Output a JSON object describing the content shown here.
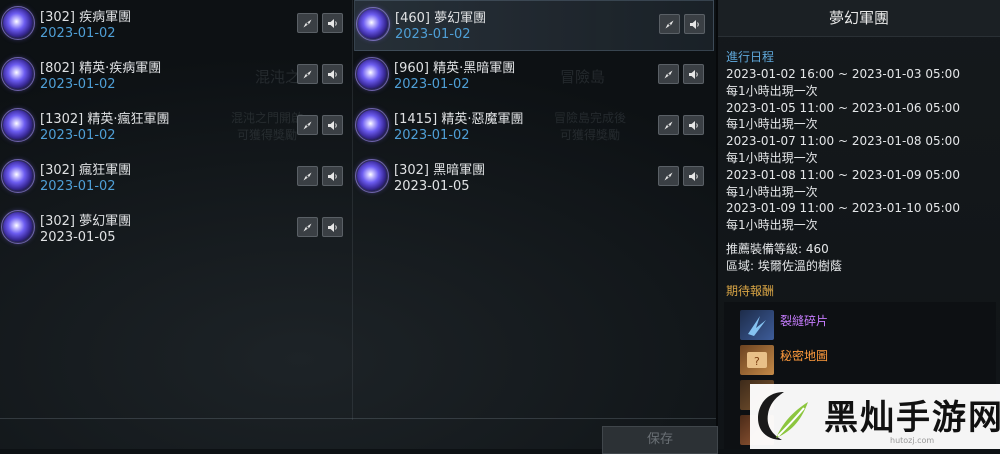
{
  "ghost_text": {
    "left_title": "混沌之",
    "left_sub1": "混沌之門開啟",
    "left_sub2": "可獲得獎勵",
    "mid_title": "冒險島",
    "mid_sub1": "冒險島完成後",
    "mid_sub2": "可獲得獎勵"
  },
  "left_list": [
    {
      "name": "[302] 疾病軍團",
      "date": "2023-01-02",
      "date_color": "blue"
    },
    {
      "name": "[802] 精英·疾病軍團",
      "date": "2023-01-02",
      "date_color": "blue"
    },
    {
      "name": "[1302] 精英·瘋狂軍團",
      "date": "2023-01-02",
      "date_color": "blue"
    },
    {
      "name": "[302] 瘋狂軍團",
      "date": "2023-01-02",
      "date_color": "blue"
    },
    {
      "name": "[302] 夢幻軍團",
      "date": "2023-01-05",
      "date_color": "white"
    }
  ],
  "mid_list": [
    {
      "name": "[460] 夢幻軍團",
      "date": "2023-01-02",
      "date_color": "blue",
      "selected": true
    },
    {
      "name": "[960] 精英·黑暗軍團",
      "date": "2023-01-02",
      "date_color": "blue"
    },
    {
      "name": "[1415] 精英·惡魔軍團",
      "date": "2023-01-02",
      "date_color": "blue"
    },
    {
      "name": "[302] 黑暗軍團",
      "date": "2023-01-05",
      "date_color": "white"
    }
  ],
  "save_label": "保存",
  "panel": {
    "title": "夢幻軍團",
    "schedule_heading": "進行日程",
    "schedule": [
      {
        "range": "2023-01-02 16:00 ~ 2023-01-03 05:00",
        "freq": "每1小時出現一次"
      },
      {
        "range": "2023-01-05 11:00 ~ 2023-01-06 05:00",
        "freq": "每1小時出現一次"
      },
      {
        "range": "2023-01-07 11:00 ~ 2023-01-08 05:00",
        "freq": "每1小時出現一次"
      },
      {
        "range": "2023-01-08 11:00 ~ 2023-01-09 05:00",
        "freq": "每1小時出現一次"
      },
      {
        "range": "2023-01-09 11:00 ~ 2023-01-10 05:00",
        "freq": "每1小時出現一次"
      }
    ],
    "gear_level": "推薦裝備等級: 460",
    "region": "區域: 埃爾佐溫的樹蔭",
    "rewards_heading": "期待報酬",
    "rewards": [
      {
        "label": "裂縫碎片",
        "color": "#c77dff"
      },
      {
        "label": "秘密地圖",
        "color": "#ff9a3c"
      }
    ]
  },
  "watermark": {
    "text": "黑灿手游网",
    "url": "hutozj.com"
  },
  "colors": {
    "accent_blue": "#4f9fd6",
    "gold": "#d9a545"
  },
  "icons": [
    "compass-icon",
    "speaker-icon",
    "orb-icon"
  ]
}
